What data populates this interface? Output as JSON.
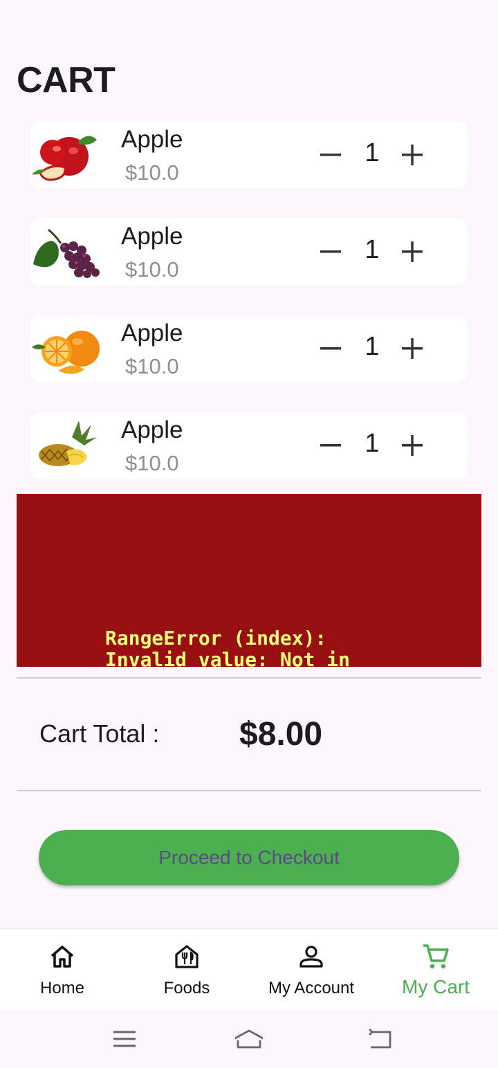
{
  "header": {
    "title": "CART"
  },
  "cart": {
    "items": [
      {
        "name": "Apple",
        "price": "$10.0",
        "quantity": "1",
        "image": "apple-image"
      },
      {
        "name": "Apple",
        "price": "$10.0",
        "quantity": "1",
        "image": "grapes-image"
      },
      {
        "name": "Apple",
        "price": "$10.0",
        "quantity": "1",
        "image": "orange-image"
      },
      {
        "name": "Apple",
        "price": "$10.0",
        "quantity": "1",
        "image": "pineapple-image"
      }
    ]
  },
  "error": {
    "message": "RangeError (index):\nInvalid value: Not in",
    "background": "#970f10",
    "text_color": "#ffff75"
  },
  "summary": {
    "total_label": "Cart Total :",
    "total_value": "$8.00"
  },
  "checkout": {
    "label": "Proceed to Checkout",
    "color": "#4caf50"
  },
  "bottom_nav": {
    "items": [
      {
        "label": "Home",
        "icon": "home-icon",
        "active": false
      },
      {
        "label": "Foods",
        "icon": "restaurant-icon",
        "active": false
      },
      {
        "label": "My Account",
        "icon": "account-icon",
        "active": false
      },
      {
        "label": "My Cart",
        "icon": "cart-icon",
        "active": true
      }
    ],
    "active_color": "#4caf50"
  },
  "system_nav": {
    "buttons": [
      "menu-icon",
      "home-outline-icon",
      "back-icon"
    ]
  }
}
